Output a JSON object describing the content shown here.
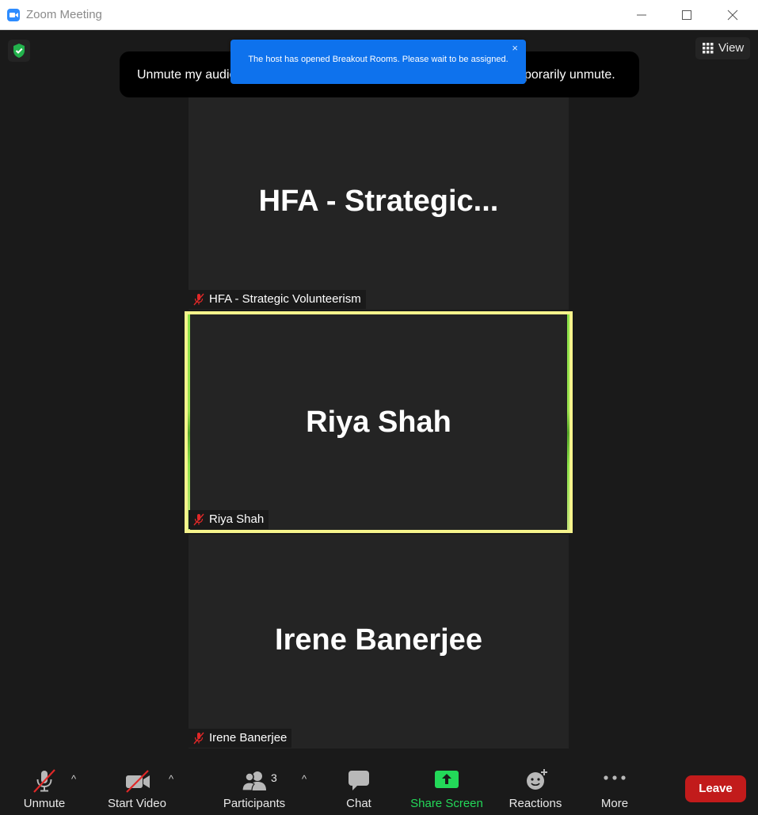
{
  "window": {
    "title": "Zoom Meeting"
  },
  "meeting": {
    "view_label": "View",
    "unmute_banner_left": "Unmute my audio",
    "unmute_banner_right": "porarily unmute.",
    "notification": {
      "message": "The host has opened Breakout Rooms. Please wait to be assigned.",
      "close": "×"
    }
  },
  "tiles": [
    {
      "display_name": "HFA  - Strategic...",
      "nametag": "HFA - Strategic Volunteerism",
      "muted": true,
      "active_speaker": false
    },
    {
      "display_name": "Riya Shah",
      "nametag": "Riya Shah",
      "muted": true,
      "active_speaker": true
    },
    {
      "display_name": "Irene Banerjee",
      "nametag": "Irene Banerjee",
      "muted": true,
      "active_speaker": false
    }
  ],
  "toolbar": {
    "unmute_label": "Unmute",
    "video_label": "Start Video",
    "participants_label": "Participants",
    "participants_count": "3",
    "chat_label": "Chat",
    "share_label": "Share Screen",
    "reactions_label": "Reactions",
    "more_label": "More",
    "leave_label": "Leave",
    "caret": "^"
  },
  "colors": {
    "accent_blue": "#0e72ed",
    "share_green": "#23d959",
    "leave_red": "#c21b1b",
    "speaker_border": "#f7f48c",
    "mute_red": "#e02828"
  }
}
